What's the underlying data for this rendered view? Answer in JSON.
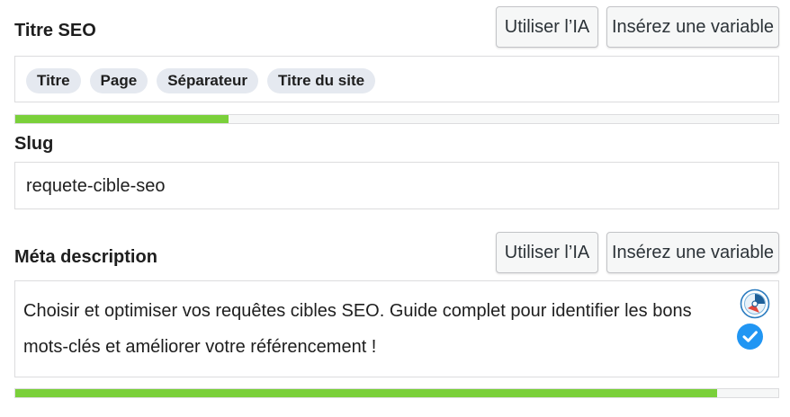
{
  "title_section": {
    "label": "Titre SEO",
    "ai_button": "Utiliser l’IA",
    "variable_button": "Insérez une variable",
    "chips": [
      "Titre",
      "Page",
      "Séparateur",
      "Titre du site"
    ],
    "progress_percent": 28
  },
  "slug_section": {
    "label": "Slug",
    "value": "requete-cible-seo"
  },
  "meta_section": {
    "label": "Méta description",
    "ai_button": "Utiliser l’IA",
    "variable_button": "Insérez une variable",
    "value": " Choisir et optimiser vos requêtes cibles SEO. Guide complet pour identifier les bons mots-clés et améliorer votre référencement !",
    "progress_percent": 92
  },
  "icons": {
    "assistant": "assistant-logo-icon",
    "check": "check-circle-icon"
  },
  "colors": {
    "progress_fill": "#7ad03a",
    "check_blue": "#2196f3"
  }
}
